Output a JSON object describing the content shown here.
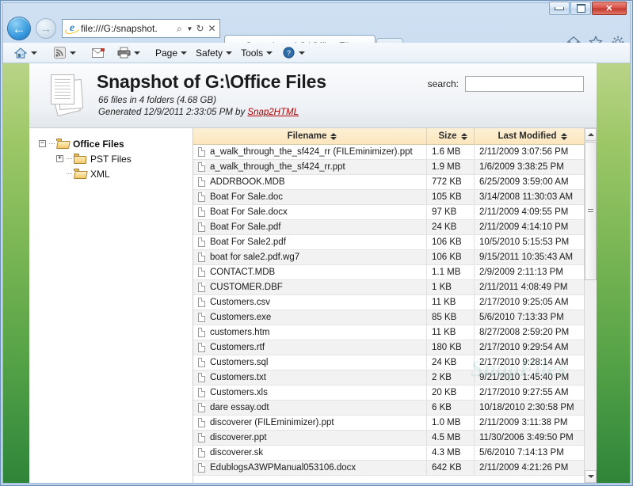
{
  "window": {
    "minimize_label": "Minimize",
    "maximize_label": "Maximize",
    "close_label": "✕"
  },
  "nav": {
    "back_glyph": "←",
    "forward_glyph": "→",
    "address_value": "file:///G:/snapshot.",
    "address_placeholder": "",
    "search_glyph": "⌕",
    "dropdown_glyph": "▼",
    "refresh_glyph": "↻",
    "stop_glyph": "✕"
  },
  "tabs": [
    {
      "title": "Snapshot of G:\\Office Files",
      "close_label": "✕"
    }
  ],
  "chrome_icons": [
    {
      "name": "home-icon",
      "glyph": "⌂"
    },
    {
      "name": "favorites-icon",
      "glyph": "☆"
    },
    {
      "name": "tools-icon",
      "glyph": "⚙"
    }
  ],
  "commandbar": {
    "home_glyph": "⌂",
    "feeds_glyph": "◗",
    "mail_glyph": "✉",
    "print_glyph": "🖶",
    "page_label": "Page",
    "safety_label": "Safety",
    "tools_label": "Tools",
    "help_glyph": "?"
  },
  "header": {
    "title": "Snapshot of G:\\Office Files",
    "summary": "66 files in 4 folders (4.68 GB)",
    "generated_prefix": "Generated 12/9/2011 2:33:05 PM by ",
    "generated_link": "Snap2HTML",
    "search_label": "search:",
    "search_value": "",
    "search_placeholder": ""
  },
  "tree": [
    {
      "label": "Office Files",
      "expander": "−",
      "level": 1,
      "bold": true,
      "folder_state": "open"
    },
    {
      "label": "PST Files",
      "expander": "+",
      "level": 2,
      "bold": false,
      "folder_state": "closed"
    },
    {
      "label": "XML",
      "expander": "",
      "level": 2,
      "bold": false,
      "folder_state": "open"
    }
  ],
  "table": {
    "columns": [
      {
        "key": "filename",
        "label": "Filename"
      },
      {
        "key": "size",
        "label": "Size"
      },
      {
        "key": "modified",
        "label": "Last Modified"
      }
    ],
    "rows": [
      {
        "filename": "a_walk_through_the_sf424_rr (FILEminimizer).ppt",
        "size": "1.6 MB",
        "modified": "2/11/2009 3:07:56 PM"
      },
      {
        "filename": "a_walk_through_the_sf424_rr.ppt",
        "size": "1.9 MB",
        "modified": "1/6/2009 3:38:25 PM"
      },
      {
        "filename": "ADDRBOOK.MDB",
        "size": "772 KB",
        "modified": "6/25/2009 3:59:00 AM"
      },
      {
        "filename": "Boat For Sale.doc",
        "size": "105 KB",
        "modified": "3/14/2008 11:30:03 AM"
      },
      {
        "filename": "Boat For Sale.docx",
        "size": "97 KB",
        "modified": "2/11/2009 4:09:55 PM"
      },
      {
        "filename": "Boat For Sale.pdf",
        "size": "24 KB",
        "modified": "2/11/2009 4:14:10 PM"
      },
      {
        "filename": "Boat For Sale2.pdf",
        "size": "106 KB",
        "modified": "10/5/2010 5:15:53 PM"
      },
      {
        "filename": "boat for sale2.pdf.wg7",
        "size": "106 KB",
        "modified": "9/15/2011 10:35:43 AM"
      },
      {
        "filename": "CONTACT.MDB",
        "size": "1.1 MB",
        "modified": "2/9/2009 2:11:13 PM"
      },
      {
        "filename": "CUSTOMER.DBF",
        "size": "1 KB",
        "modified": "2/11/2011 4:08:49 PM"
      },
      {
        "filename": "Customers.csv",
        "size": "11 KB",
        "modified": "2/17/2010 9:25:05 AM"
      },
      {
        "filename": "Customers.exe",
        "size": "85 KB",
        "modified": "5/6/2010 7:13:33 PM"
      },
      {
        "filename": "customers.htm",
        "size": "11 KB",
        "modified": "8/27/2008 2:59:20 PM"
      },
      {
        "filename": "Customers.rtf",
        "size": "180 KB",
        "modified": "2/17/2010 9:29:54 AM"
      },
      {
        "filename": "Customers.sql",
        "size": "24 KB",
        "modified": "2/17/2010 9:28:14 AM"
      },
      {
        "filename": "Customers.txt",
        "size": "2 KB",
        "modified": "9/21/2010 1:45:40 PM"
      },
      {
        "filename": "Customers.xls",
        "size": "20 KB",
        "modified": "2/17/2010 9:27:55 AM"
      },
      {
        "filename": "dare essay.odt",
        "size": "6 KB",
        "modified": "10/18/2010 2:30:58 PM"
      },
      {
        "filename": "discoverer (FILEminimizer).ppt",
        "size": "1.0 MB",
        "modified": "2/11/2009 3:11:38 PM"
      },
      {
        "filename": "discoverer.ppt",
        "size": "4.5 MB",
        "modified": "11/30/2006 3:49:50 PM"
      },
      {
        "filename": "discoverer.sk",
        "size": "4.3 MB",
        "modified": "5/6/2010 7:14:13 PM"
      },
      {
        "filename": "EdublogsA3WPManual053106.docx",
        "size": "642 KB",
        "modified": "2/11/2009 4:21:26 PM"
      }
    ]
  },
  "watermark": {
    "text": "SnapFiles"
  },
  "colors": {
    "header_band": "#fbe6bd",
    "link": "#b00000",
    "green_top": "#b9d487",
    "green_bottom": "#2f8438",
    "close_button": "#c33a2d"
  }
}
